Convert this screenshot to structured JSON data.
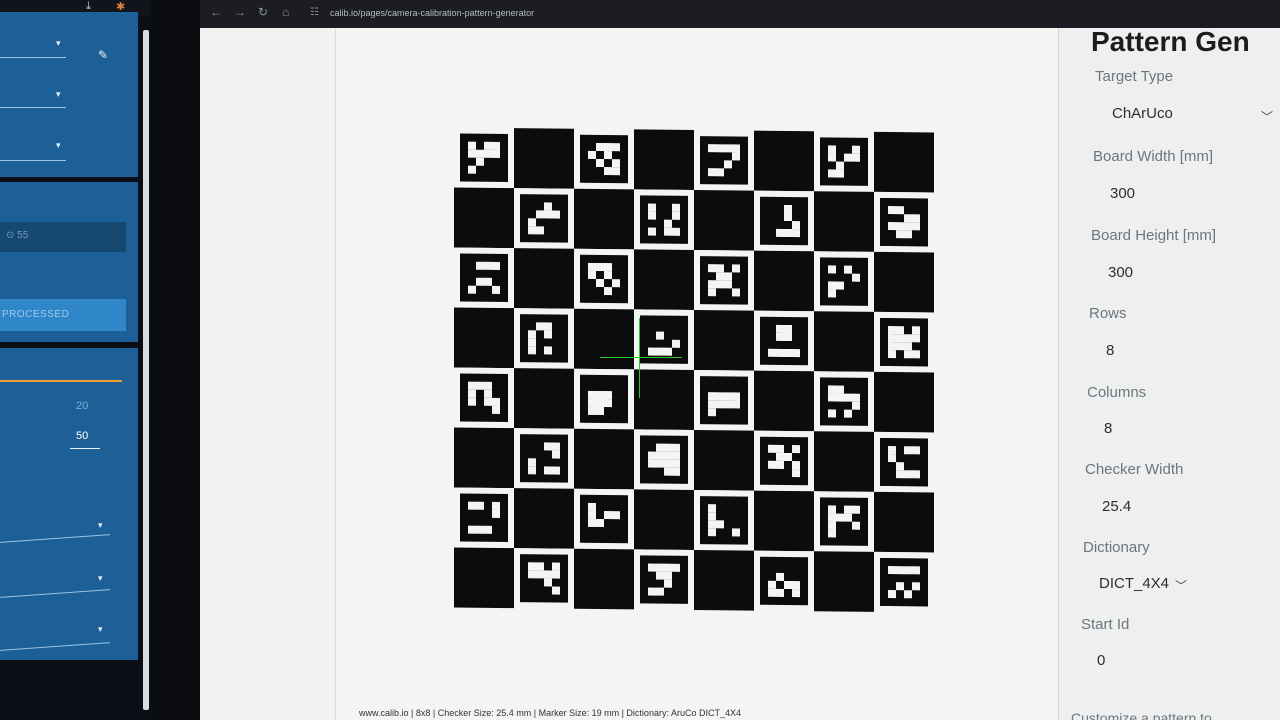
{
  "left_monitor": {
    "dark_field_text": "⊙ 55",
    "button_label": "PROCESSED",
    "values": [
      "20",
      "50"
    ]
  },
  "browser": {
    "url": "calib.io/pages/camera-calibration-pattern-generator"
  },
  "board": {
    "rows": 8,
    "columns": 8,
    "first_cell_black": false
  },
  "footer_info": "www.calib.io | 8x8 | Checker Size: 25.4 mm | Marker Size: 19 mm | Dictionary: AruCo DICT_4X4",
  "settings": {
    "title": "Pattern Gen",
    "fields": [
      {
        "key": "target_type",
        "label": "Target Type",
        "value": "ChArUco",
        "dropdown": true
      },
      {
        "key": "board_width",
        "label": "Board Width [mm]",
        "value": "300",
        "dropdown": false
      },
      {
        "key": "board_height",
        "label": "Board Height [mm]",
        "value": "300",
        "dropdown": false
      },
      {
        "key": "rows",
        "label": "Rows",
        "value": "8",
        "dropdown": false
      },
      {
        "key": "columns",
        "label": "Columns",
        "value": "8",
        "dropdown": false
      },
      {
        "key": "checker_width",
        "label": "Checker Width",
        "value": "25.4",
        "dropdown": false
      },
      {
        "key": "dictionary",
        "label": "Dictionary",
        "value": "DICT_4X4",
        "dropdown": true
      },
      {
        "key": "start_id",
        "label": "Start Id",
        "value": "0",
        "dropdown": false
      }
    ],
    "footer": "Customize a pattern to"
  },
  "icons": [
    "download-icon",
    "extension-icon",
    "back-icon",
    "forward-icon",
    "reload-icon",
    "home-icon",
    "site-settings-icon",
    "pencil-icon",
    "chevron-down-icon"
  ]
}
